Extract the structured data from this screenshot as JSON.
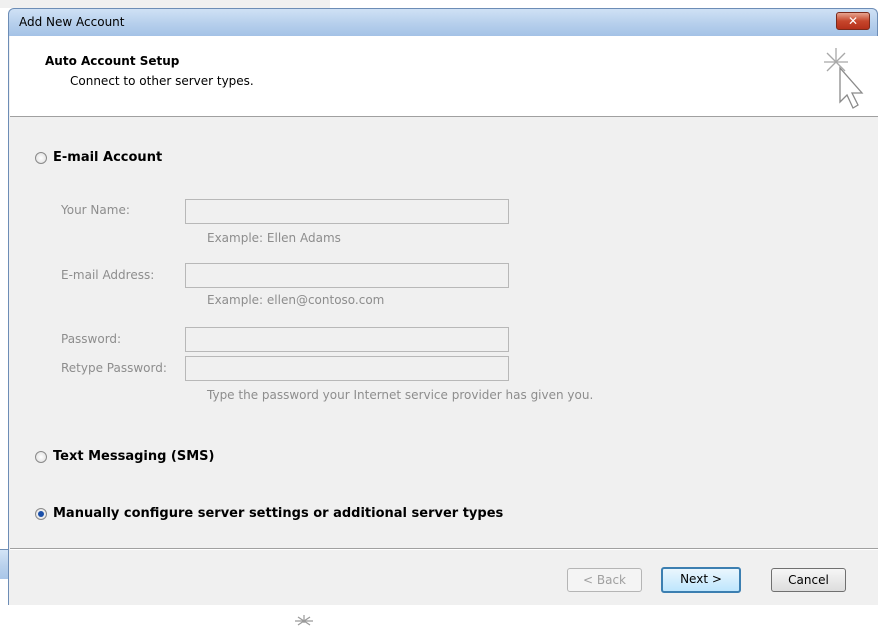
{
  "window": {
    "title": "Add New Account",
    "close_glyph": "✕"
  },
  "header": {
    "title": "Auto Account Setup",
    "subtitle": "Connect to other server types.",
    "icon": "cursor-sparkle-icon"
  },
  "options": {
    "email_account": {
      "label": "E-mail Account",
      "selected": false
    },
    "text_messaging": {
      "label": "Text Messaging (SMS)",
      "selected": false
    },
    "manual_config": {
      "label": "Manually configure server settings or additional server types",
      "selected": true
    }
  },
  "email_form": {
    "your_name": {
      "label": "Your Name:",
      "value": "",
      "hint": "Example: Ellen Adams"
    },
    "email_address": {
      "label": "E-mail Address:",
      "value": "",
      "hint": "Example: ellen@contoso.com"
    },
    "password": {
      "label": "Password:",
      "value": ""
    },
    "retype_password": {
      "label": "Retype Password:",
      "value": "",
      "hint": "Type the password your Internet service provider has given you."
    }
  },
  "buttons": {
    "back": "< Back",
    "next": "Next >",
    "cancel": "Cancel"
  },
  "background_window": {
    "close_glyph": "✕",
    "icon": "cursor-sparkle-icon"
  },
  "colors": {
    "titlebar": "#b6cfec",
    "close_button": "#c6462c",
    "disabled_text": "#8d8d8d",
    "radio_selected": "#1a4fa8"
  }
}
